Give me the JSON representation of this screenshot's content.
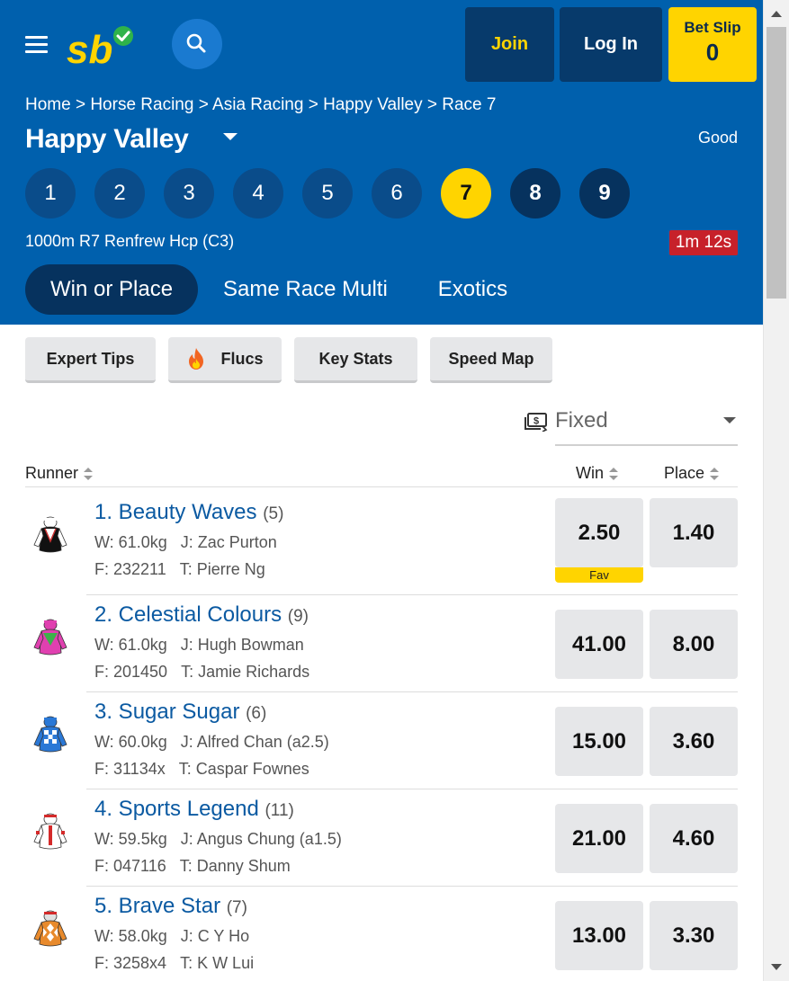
{
  "header": {
    "join_label": "Join",
    "login_label": "Log In",
    "betslip_label": "Bet Slip",
    "betslip_count": "0"
  },
  "breadcrumb": "Home > Horse Racing > Asia Racing > Happy Valley > Race 7",
  "venue": "Happy Valley",
  "track_condition": "Good",
  "race_numbers": [
    "1",
    "2",
    "3",
    "4",
    "5",
    "6",
    "7",
    "8",
    "9"
  ],
  "active_race": "7",
  "race_info": "1000m R7 Renfrew Hcp (C3)",
  "countdown": "1m 12s",
  "market_tabs": [
    "Win or Place",
    "Same Race Multi",
    "Exotics"
  ],
  "tools": [
    "Expert Tips",
    "Flucs",
    "Key Stats",
    "Speed Map"
  ],
  "price_type": "Fixed",
  "columns": {
    "runner": "Runner",
    "win": "Win",
    "place": "Place"
  },
  "fav_label": "Fav",
  "runners": [
    {
      "name": "1. Beauty Waves",
      "barrier": "(5)",
      "weight": "W: 61.0kg",
      "jockey": "J: Zac Purton",
      "form": "F: 232211",
      "trainer": "T: Pierre Ng",
      "win": "2.50",
      "place": "1.40",
      "fav": true
    },
    {
      "name": "2. Celestial Colours",
      "barrier": "(9)",
      "weight": "W: 61.0kg",
      "jockey": "J: Hugh Bowman",
      "form": "F: 201450",
      "trainer": "T: Jamie Richards",
      "win": "41.00",
      "place": "8.00",
      "fav": false
    },
    {
      "name": "3. Sugar Sugar",
      "barrier": "(6)",
      "weight": "W: 60.0kg",
      "jockey": "J: Alfred Chan (a2.5)",
      "form": "F: 31134x",
      "trainer": "T: Caspar Fownes",
      "win": "15.00",
      "place": "3.60",
      "fav": false
    },
    {
      "name": "4. Sports Legend",
      "barrier": "(11)",
      "weight": "W: 59.5kg",
      "jockey": "J: Angus Chung (a1.5)",
      "form": "F: 047116",
      "trainer": "T: Danny Shum",
      "win": "21.00",
      "place": "4.60",
      "fav": false
    },
    {
      "name": "5. Brave Star",
      "barrier": "(7)",
      "weight": "W: 58.0kg",
      "jockey": "J: C Y Ho",
      "form": "F: 3258x4",
      "trainer": "T: K W Lui",
      "win": "13.00",
      "place": "3.30",
      "fav": false
    }
  ],
  "colors": {
    "header_blue": "#0060ad",
    "dark_navy": "#06325e",
    "accent_yellow": "#ffd400",
    "countdown_red": "#c7212a",
    "link_blue": "#0b5aa2"
  }
}
